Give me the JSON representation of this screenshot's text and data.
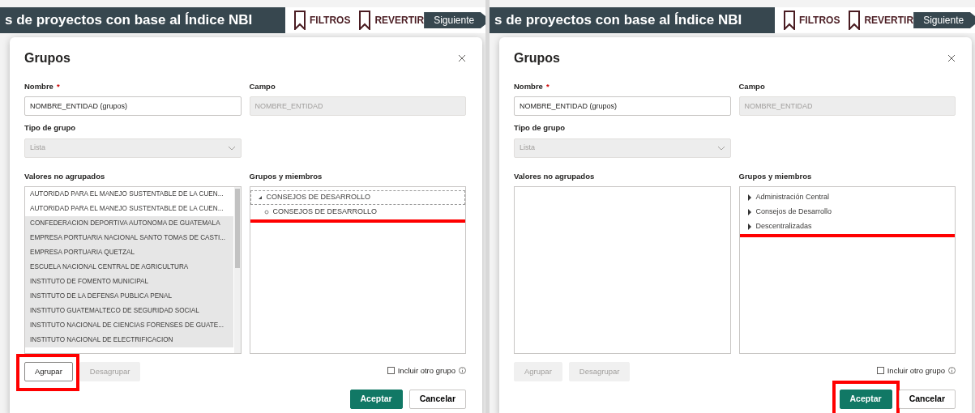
{
  "panels": [
    {
      "header": {
        "title": "s de proyectos con base al Índice NBI",
        "actions": [
          {
            "label": "FILTROS"
          },
          {
            "label": "REVERTIR"
          }
        ],
        "next_button": "Siguiente"
      },
      "dialog": {
        "title": "Grupos",
        "name_field": {
          "label": "Nombre",
          "required_mark": "*",
          "value": "NOMBRE_ENTIDAD (grupos)"
        },
        "field_field": {
          "label": "Campo",
          "value": "NOMBRE_ENTIDAD",
          "disabled": true
        },
        "group_type": {
          "label": "Tipo de grupo",
          "value": "Lista",
          "disabled": true
        },
        "ungrouped": {
          "label": "Valores no agrupados",
          "items": [
            {
              "text": "AUTORIDAD PARA EL MANEJO SUSTENTABLE DE LA CUEN...",
              "selected": false
            },
            {
              "text": "AUTORIDAD PARA EL MANEJO SUSTENTABLE DE LA CUEN...",
              "selected": false
            },
            {
              "text": "CONFEDERACION DEPORTIVA AUTONOMA DE GUATEMALA",
              "selected": true
            },
            {
              "text": "EMPRESA PORTUARIA NACIONAL SANTO TOMAS DE CASTI...",
              "selected": true
            },
            {
              "text": "EMPRESA PORTUARIA QUETZAL",
              "selected": true
            },
            {
              "text": "ESCUELA NACIONAL CENTRAL DE AGRICULTURA",
              "selected": true
            },
            {
              "text": "INSTITUTO DE FOMENTO MUNICIPAL",
              "selected": true
            },
            {
              "text": "INSTITUTO DE LA DEFENSA PUBLICA PENAL",
              "selected": true
            },
            {
              "text": "INSTITUTO GUATEMALTECO DE SEGURIDAD SOCIAL",
              "selected": true
            },
            {
              "text": "INSTITUTO NACIONAL DE CIENCIAS FORENSES DE GUATE...",
              "selected": true
            },
            {
              "text": "INSTITUTO NACIONAL DE ELECTRIFICACION",
              "selected": true
            }
          ]
        },
        "groups": {
          "label": "Grupos y miembros",
          "highlighted": true,
          "items": [
            {
              "text": "CONSEJOS DE DESARROLLO",
              "expanded": true,
              "selected": true,
              "children": [
                {
                  "text": "CONSEJOS DE DESARROLLO"
                }
              ]
            }
          ]
        },
        "buttons": [
          {
            "label": "Agrupar",
            "disabled": false,
            "highlighted": true
          },
          {
            "label": "Desagrupar",
            "disabled": true,
            "highlighted": false
          }
        ],
        "include_other": {
          "label": "Incluir otro grupo",
          "checked": false
        },
        "footer_buttons": [
          {
            "kind": "primary",
            "label": "Aceptar",
            "highlighted": false
          },
          {
            "kind": "secondary",
            "label": "Cancelar",
            "highlighted": false
          }
        ]
      }
    },
    {
      "header": {
        "title": "s de proyectos con base al Índice NBI",
        "actions": [
          {
            "label": "FILTROS"
          },
          {
            "label": "REVERTIR"
          }
        ],
        "next_button": "Siguiente"
      },
      "dialog": {
        "title": "Grupos",
        "name_field": {
          "label": "Nombre",
          "required_mark": "*",
          "value": "NOMBRE_ENTIDAD (grupos)"
        },
        "field_field": {
          "label": "Campo",
          "value": "NOMBRE_ENTIDAD",
          "disabled": true
        },
        "group_type": {
          "label": "Tipo de grupo",
          "value": "Lista",
          "disabled": true
        },
        "ungrouped": {
          "label": "Valores no agrupados"
        },
        "groups": {
          "label": "Grupos y miembros",
          "highlighted": true,
          "items": [
            {
              "text": "Administración Central",
              "expanded": false,
              "selected": false
            },
            {
              "text": "Consejos de Desarrollo",
              "expanded": false,
              "selected": false
            },
            {
              "text": "Descentralizadas",
              "expanded": false,
              "selected": false
            }
          ]
        },
        "buttons": [
          {
            "label": "Agrupar",
            "disabled": true,
            "highlighted": false
          },
          {
            "label": "Desagrupar",
            "disabled": true,
            "highlighted": false
          }
        ],
        "include_other": {
          "label": "Incluir otro grupo",
          "checked": false
        },
        "footer_buttons": [
          {
            "kind": "primary",
            "label": "Aceptar",
            "highlighted": true
          },
          {
            "kind": "secondary",
            "label": "Cancelar",
            "highlighted": false
          }
        ]
      }
    }
  ]
}
